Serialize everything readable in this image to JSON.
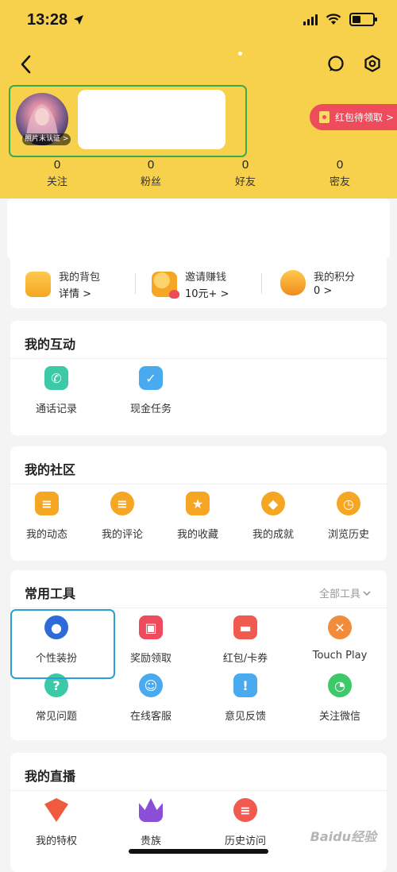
{
  "status_bar": {
    "time": "13:28"
  },
  "profile": {
    "verify_badge": "照片未认证 >"
  },
  "redpacket_button": "红包待领取 >",
  "stats": [
    {
      "num": "0",
      "label": "关注"
    },
    {
      "num": "0",
      "label": "粉丝"
    },
    {
      "num": "0",
      "label": "好友"
    },
    {
      "num": "0",
      "label": "密友"
    }
  ],
  "quick_links": [
    {
      "title": "我的背包",
      "sub": "详情 >"
    },
    {
      "title": "邀请赚钱",
      "sub": "10元+ >"
    },
    {
      "title": "我的积分",
      "sub": "0 >"
    }
  ],
  "interaction": {
    "title": "我的互动",
    "items": [
      "通话记录",
      "现金任务"
    ]
  },
  "community": {
    "title": "我的社区",
    "items": [
      "我的动态",
      "我的评论",
      "我的收藏",
      "我的成就",
      "浏览历史"
    ]
  },
  "tools": {
    "title": "常用工具",
    "all_link": "全部工具",
    "items": [
      "个性装扮",
      "奖励领取",
      "红包/卡券",
      "Touch Play",
      "常见问题",
      "在线客服",
      "意见反馈",
      "关注微信"
    ]
  },
  "live": {
    "title": "我的直播",
    "items": [
      "我的特权",
      "贵族",
      "历史访问"
    ]
  },
  "watermark": "Baidu经验",
  "colors": {
    "header_yellow": "#f7d14c",
    "accent_red": "#ee4c5c",
    "highlight_green": "#3aab4c",
    "highlight_blue": "#2a9fd6"
  }
}
